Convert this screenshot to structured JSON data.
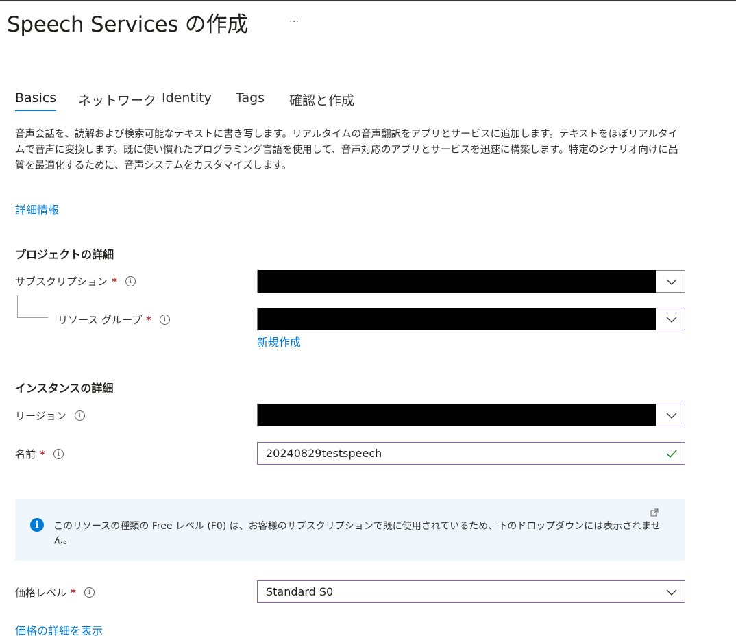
{
  "header": {
    "title": "Speech Services の作成",
    "more": "…"
  },
  "tabs": [
    {
      "label": "Basics",
      "active": true
    },
    {
      "label": "ネットワーク"
    },
    {
      "label": "Identity"
    },
    {
      "label": "Tags"
    },
    {
      "label": "確認と作成"
    }
  ],
  "description": "音声会話を、読解および検索可能なテキストに書き写します。リアルタイムの音声翻訳をアプリとサービスに追加します。テキストをほぼリアルタイムで音声に変換します。既に使い慣れたプログラミング言語を使用して、音声対応のアプリとサービスを迅速に構築します。特定のシナリオ向けに品質を最適化するために、音声システムをカスタマイズします。",
  "learn_more": "詳細情報",
  "project": {
    "section_title": "プロジェクトの詳細",
    "subscription_label": "サブスクリプション",
    "resource_group_label": "リソース グループ",
    "create_new": "新規作成"
  },
  "instance": {
    "section_title": "インスタンスの詳細",
    "region_label": "リージョン",
    "name_label": "名前",
    "name_value": "20240829testspeech"
  },
  "notice": {
    "text": "このリソースの種類の Free レベル (F0) は、お客様のサブスクリプションで既に使用されているため、下のドロップダウンには表示されません。"
  },
  "pricing": {
    "label": "価格レベル",
    "value": "Standard S0",
    "details_link": "価格の詳細を表示"
  },
  "common": {
    "required": "*",
    "info": "i"
  },
  "colors": {
    "accent": "#0078d4",
    "required": "#a4262c",
    "focus_border": "#8764b8",
    "valid": "#107c10",
    "notice_bg": "#eff6fc"
  }
}
